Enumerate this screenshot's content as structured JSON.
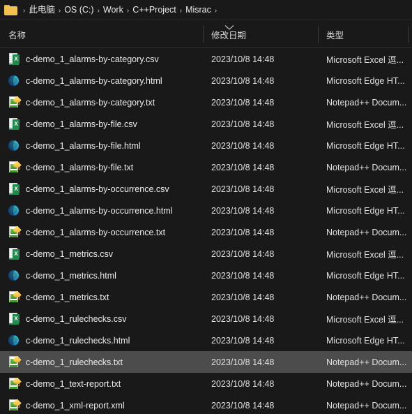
{
  "window": {
    "background_color": "#191919",
    "text_color": "#e8e8e8",
    "selection_color": "#4c4c4c"
  },
  "breadcrumb": {
    "folder_icon": "folder-icon",
    "separator": "›",
    "items": [
      {
        "label": "此电脑"
      },
      {
        "label": "OS (C:)"
      },
      {
        "label": "Work"
      },
      {
        "label": "C++Project"
      },
      {
        "label": "Misrac"
      }
    ]
  },
  "columns": {
    "name": "名称",
    "date_modified": "修改日期",
    "type": "类型",
    "sort_icon": "chevron-down-icon",
    "sorted_by": "修改日期"
  },
  "files": [
    {
      "name": "c-demo_1_alarms-by-category.csv",
      "icon": "excel-csv-icon",
      "date": "2023/10/8 14:48",
      "type": "Microsoft Excel 逗...",
      "selected": false
    },
    {
      "name": "c-demo_1_alarms-by-category.html",
      "icon": "microsoft-edge-icon",
      "date": "2023/10/8 14:48",
      "type": "Microsoft Edge HT...",
      "selected": false
    },
    {
      "name": "c-demo_1_alarms-by-category.txt",
      "icon": "notepadpp-icon",
      "date": "2023/10/8 14:48",
      "type": "Notepad++ Docum...",
      "selected": false
    },
    {
      "name": "c-demo_1_alarms-by-file.csv",
      "icon": "excel-csv-icon",
      "date": "2023/10/8 14:48",
      "type": "Microsoft Excel 逗...",
      "selected": false
    },
    {
      "name": "c-demo_1_alarms-by-file.html",
      "icon": "microsoft-edge-icon",
      "date": "2023/10/8 14:48",
      "type": "Microsoft Edge HT...",
      "selected": false
    },
    {
      "name": "c-demo_1_alarms-by-file.txt",
      "icon": "notepadpp-icon",
      "date": "2023/10/8 14:48",
      "type": "Notepad++ Docum...",
      "selected": false
    },
    {
      "name": "c-demo_1_alarms-by-occurrence.csv",
      "icon": "excel-csv-icon",
      "date": "2023/10/8 14:48",
      "type": "Microsoft Excel 逗...",
      "selected": false
    },
    {
      "name": "c-demo_1_alarms-by-occurrence.html",
      "icon": "microsoft-edge-icon",
      "date": "2023/10/8 14:48",
      "type": "Microsoft Edge HT...",
      "selected": false
    },
    {
      "name": "c-demo_1_alarms-by-occurrence.txt",
      "icon": "notepadpp-icon",
      "date": "2023/10/8 14:48",
      "type": "Notepad++ Docum...",
      "selected": false
    },
    {
      "name": "c-demo_1_metrics.csv",
      "icon": "excel-csv-icon",
      "date": "2023/10/8 14:48",
      "type": "Microsoft Excel 逗...",
      "selected": false
    },
    {
      "name": "c-demo_1_metrics.html",
      "icon": "microsoft-edge-icon",
      "date": "2023/10/8 14:48",
      "type": "Microsoft Edge HT...",
      "selected": false
    },
    {
      "name": "c-demo_1_metrics.txt",
      "icon": "notepadpp-icon",
      "date": "2023/10/8 14:48",
      "type": "Notepad++ Docum...",
      "selected": false
    },
    {
      "name": "c-demo_1_rulechecks.csv",
      "icon": "excel-csv-icon",
      "date": "2023/10/8 14:48",
      "type": "Microsoft Excel 逗...",
      "selected": false
    },
    {
      "name": "c-demo_1_rulechecks.html",
      "icon": "microsoft-edge-icon",
      "date": "2023/10/8 14:48",
      "type": "Microsoft Edge HT...",
      "selected": false
    },
    {
      "name": "c-demo_1_rulechecks.txt",
      "icon": "notepadpp-icon",
      "date": "2023/10/8 14:48",
      "type": "Notepad++ Docum...",
      "selected": true
    },
    {
      "name": "c-demo_1_text-report.txt",
      "icon": "notepadpp-icon",
      "date": "2023/10/8 14:48",
      "type": "Notepad++ Docum...",
      "selected": false
    },
    {
      "name": "c-demo_1_xml-report.xml",
      "icon": "notepadpp-icon",
      "date": "2023/10/8 14:48",
      "type": "Notepad++ Docum...",
      "selected": false
    }
  ]
}
